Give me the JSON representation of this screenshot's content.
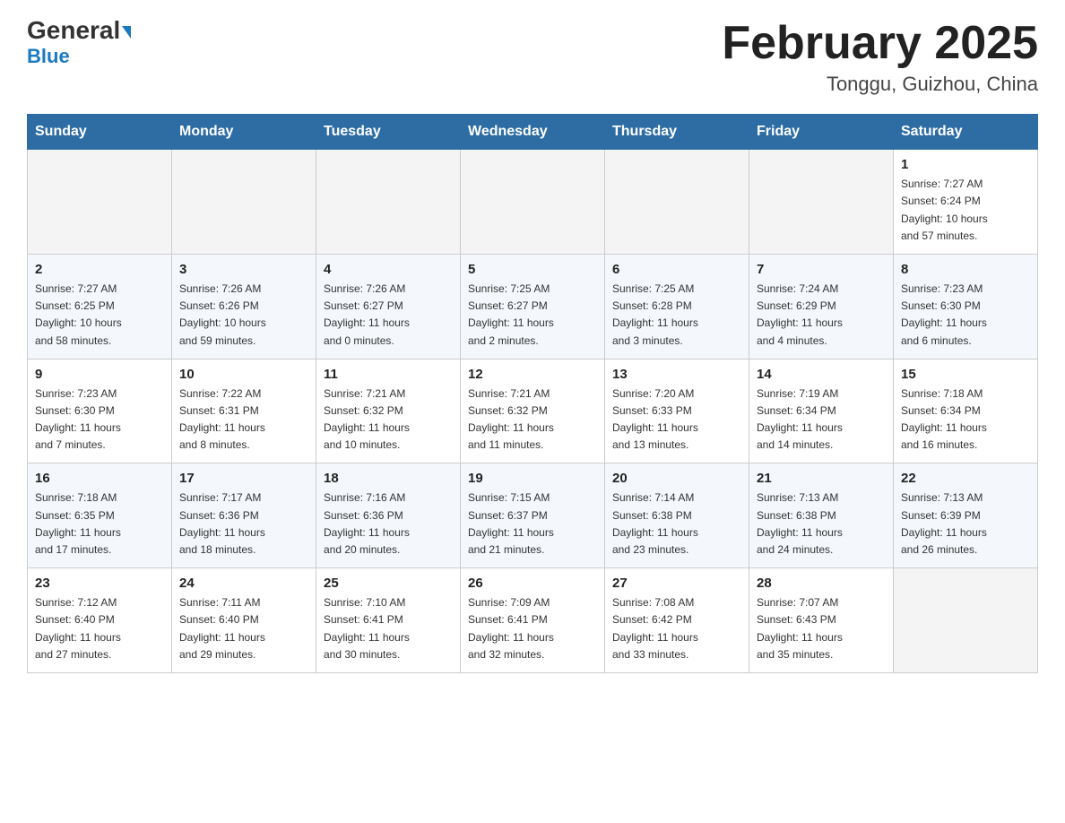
{
  "header": {
    "logo_general": "General",
    "logo_blue": "Blue",
    "month_title": "February 2025",
    "location": "Tonggu, Guizhou, China"
  },
  "days_of_week": [
    "Sunday",
    "Monday",
    "Tuesday",
    "Wednesday",
    "Thursday",
    "Friday",
    "Saturday"
  ],
  "weeks": [
    [
      {
        "day": "",
        "info": ""
      },
      {
        "day": "",
        "info": ""
      },
      {
        "day": "",
        "info": ""
      },
      {
        "day": "",
        "info": ""
      },
      {
        "day": "",
        "info": ""
      },
      {
        "day": "",
        "info": ""
      },
      {
        "day": "1",
        "info": "Sunrise: 7:27 AM\nSunset: 6:24 PM\nDaylight: 10 hours\nand 57 minutes."
      }
    ],
    [
      {
        "day": "2",
        "info": "Sunrise: 7:27 AM\nSunset: 6:25 PM\nDaylight: 10 hours\nand 58 minutes."
      },
      {
        "day": "3",
        "info": "Sunrise: 7:26 AM\nSunset: 6:26 PM\nDaylight: 10 hours\nand 59 minutes."
      },
      {
        "day": "4",
        "info": "Sunrise: 7:26 AM\nSunset: 6:27 PM\nDaylight: 11 hours\nand 0 minutes."
      },
      {
        "day": "5",
        "info": "Sunrise: 7:25 AM\nSunset: 6:27 PM\nDaylight: 11 hours\nand 2 minutes."
      },
      {
        "day": "6",
        "info": "Sunrise: 7:25 AM\nSunset: 6:28 PM\nDaylight: 11 hours\nand 3 minutes."
      },
      {
        "day": "7",
        "info": "Sunrise: 7:24 AM\nSunset: 6:29 PM\nDaylight: 11 hours\nand 4 minutes."
      },
      {
        "day": "8",
        "info": "Sunrise: 7:23 AM\nSunset: 6:30 PM\nDaylight: 11 hours\nand 6 minutes."
      }
    ],
    [
      {
        "day": "9",
        "info": "Sunrise: 7:23 AM\nSunset: 6:30 PM\nDaylight: 11 hours\nand 7 minutes."
      },
      {
        "day": "10",
        "info": "Sunrise: 7:22 AM\nSunset: 6:31 PM\nDaylight: 11 hours\nand 8 minutes."
      },
      {
        "day": "11",
        "info": "Sunrise: 7:21 AM\nSunset: 6:32 PM\nDaylight: 11 hours\nand 10 minutes."
      },
      {
        "day": "12",
        "info": "Sunrise: 7:21 AM\nSunset: 6:32 PM\nDaylight: 11 hours\nand 11 minutes."
      },
      {
        "day": "13",
        "info": "Sunrise: 7:20 AM\nSunset: 6:33 PM\nDaylight: 11 hours\nand 13 minutes."
      },
      {
        "day": "14",
        "info": "Sunrise: 7:19 AM\nSunset: 6:34 PM\nDaylight: 11 hours\nand 14 minutes."
      },
      {
        "day": "15",
        "info": "Sunrise: 7:18 AM\nSunset: 6:34 PM\nDaylight: 11 hours\nand 16 minutes."
      }
    ],
    [
      {
        "day": "16",
        "info": "Sunrise: 7:18 AM\nSunset: 6:35 PM\nDaylight: 11 hours\nand 17 minutes."
      },
      {
        "day": "17",
        "info": "Sunrise: 7:17 AM\nSunset: 6:36 PM\nDaylight: 11 hours\nand 18 minutes."
      },
      {
        "day": "18",
        "info": "Sunrise: 7:16 AM\nSunset: 6:36 PM\nDaylight: 11 hours\nand 20 minutes."
      },
      {
        "day": "19",
        "info": "Sunrise: 7:15 AM\nSunset: 6:37 PM\nDaylight: 11 hours\nand 21 minutes."
      },
      {
        "day": "20",
        "info": "Sunrise: 7:14 AM\nSunset: 6:38 PM\nDaylight: 11 hours\nand 23 minutes."
      },
      {
        "day": "21",
        "info": "Sunrise: 7:13 AM\nSunset: 6:38 PM\nDaylight: 11 hours\nand 24 minutes."
      },
      {
        "day": "22",
        "info": "Sunrise: 7:13 AM\nSunset: 6:39 PM\nDaylight: 11 hours\nand 26 minutes."
      }
    ],
    [
      {
        "day": "23",
        "info": "Sunrise: 7:12 AM\nSunset: 6:40 PM\nDaylight: 11 hours\nand 27 minutes."
      },
      {
        "day": "24",
        "info": "Sunrise: 7:11 AM\nSunset: 6:40 PM\nDaylight: 11 hours\nand 29 minutes."
      },
      {
        "day": "25",
        "info": "Sunrise: 7:10 AM\nSunset: 6:41 PM\nDaylight: 11 hours\nand 30 minutes."
      },
      {
        "day": "26",
        "info": "Sunrise: 7:09 AM\nSunset: 6:41 PM\nDaylight: 11 hours\nand 32 minutes."
      },
      {
        "day": "27",
        "info": "Sunrise: 7:08 AM\nSunset: 6:42 PM\nDaylight: 11 hours\nand 33 minutes."
      },
      {
        "day": "28",
        "info": "Sunrise: 7:07 AM\nSunset: 6:43 PM\nDaylight: 11 hours\nand 35 minutes."
      },
      {
        "day": "",
        "info": ""
      }
    ]
  ]
}
